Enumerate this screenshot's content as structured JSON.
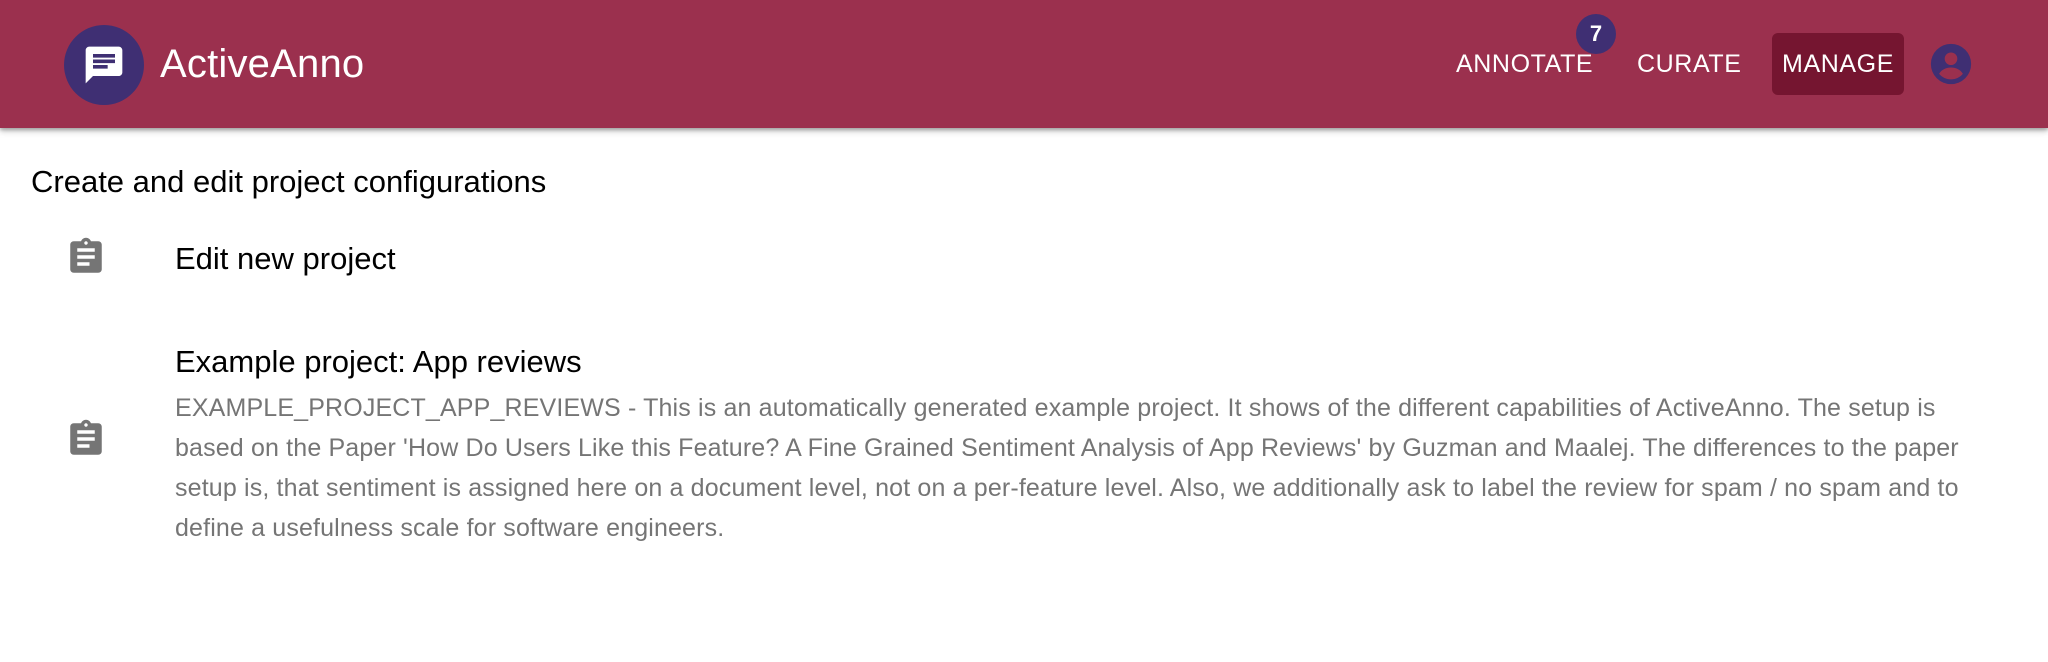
{
  "app": {
    "title": "ActiveAnno",
    "logo_icon": "chat-message-icon",
    "colors": {
      "appbar": "#9b304e",
      "accent": "#3f2f73",
      "active_nav": "#751530"
    }
  },
  "nav": {
    "annotate": {
      "label": "ANNOTATE",
      "badge": "7"
    },
    "curate": {
      "label": "CURATE"
    },
    "manage": {
      "label": "MANAGE",
      "active": true
    },
    "account_icon": "account-circle-icon"
  },
  "main": {
    "heading": "Create and edit project configurations",
    "projects": [
      {
        "icon": "clipboard-icon",
        "title": "Edit new project"
      },
      {
        "icon": "clipboard-icon",
        "title": "Example project: App reviews",
        "description": "EXAMPLE_PROJECT_APP_REVIEWS - This is an automatically generated example project. It shows of the different capabilities of ActiveAnno. The setup is based on the Paper 'How Do Users Like this Feature? A Fine Grained Sentiment Analysis of App Reviews' by Guzman and Maalej. The differences to the paper setup is, that sentiment is assigned here on a document level, not on a per-feature level. Also, we additionally ask to label the review for spam / no spam and to define a usefulness scale for software engineers."
      }
    ]
  }
}
